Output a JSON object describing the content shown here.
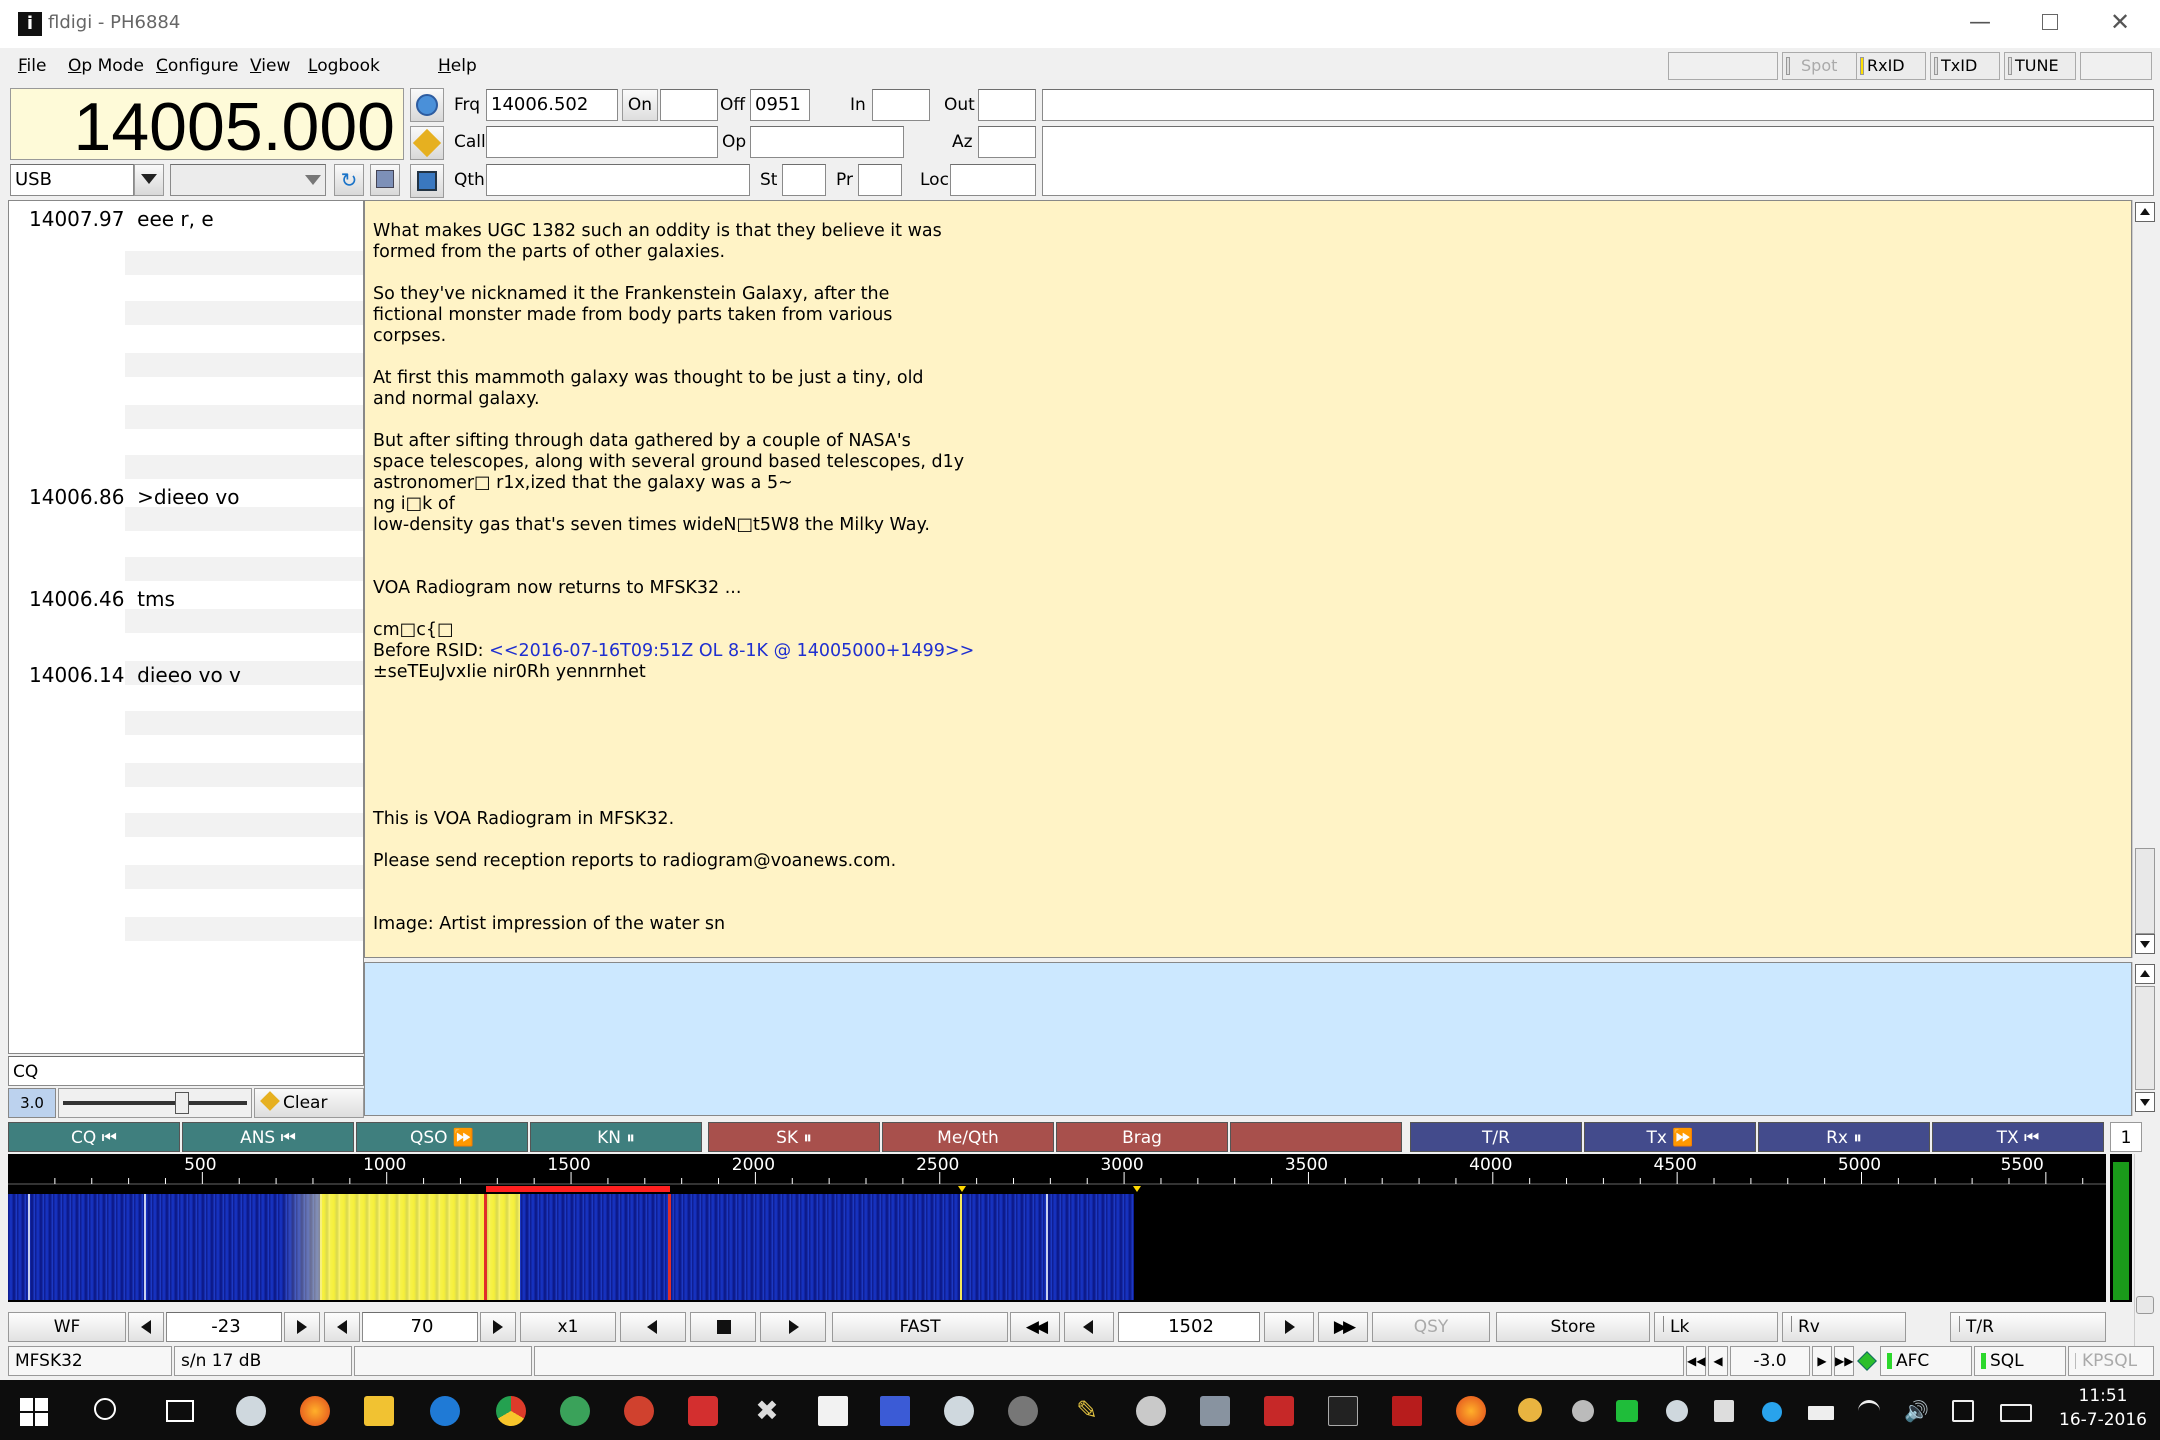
{
  "window": {
    "title": "fldigi - PH6884"
  },
  "menu": [
    "File",
    "Op Mode",
    "Configure",
    "View",
    "Logbook",
    "Help"
  ],
  "toolbar_right": {
    "spot": "Spot",
    "rxid": "RxID",
    "txid": "TxID",
    "tune": "TUNE"
  },
  "freq_display": "14005.000",
  "mode_select": "USB",
  "log": {
    "frq_label": "Frq",
    "frq_value": "14006.502",
    "on_label": "On",
    "on_value": "",
    "off_label": "Off",
    "off_value": "0951",
    "in_label": "In",
    "in_value": "",
    "out_label": "Out",
    "out_value": "",
    "call_label": "Call",
    "call_value": "",
    "op_label": "Op",
    "op_value": "",
    "az_label": "Az",
    "az_value": "",
    "qth_label": "Qth",
    "qth_value": "",
    "st_label": "St",
    "st_value": "",
    "pr_label": "Pr",
    "pr_value": "",
    "loc_label": "Loc",
    "loc_value": ""
  },
  "signal_browser": [
    {
      "freq": "14007.97",
      "text": "eee r,  e"
    },
    {
      "freq": "14006.86",
      "text": ">dieeo vo"
    },
    {
      "freq": "14006.46",
      "text": "tms"
    },
    {
      "freq": "14006.14",
      "text": "dieeo vo v"
    }
  ],
  "browser_search": "CQ",
  "browser_squelch_value": "3.0",
  "browser_clear": "Clear",
  "rx_lines": [
    "What makes UGC 1382 such an oddity is that they believe it was",
    "formed from the parts of other galaxies.",
    "So they've nicknamed it the Frankenstein Galaxy, after the",
    "fictional monster made from body parts taken from various",
    "corpses.",
    "At first this mammoth galaxy was thought to be just a tiny, old",
    "and normal galaxy.",
    "But after sifting through data gathered by a couple of NASA's",
    "space telescopes, along with several ground based telescopes, d1y",
    "astronomer□ r1x,ized that the galaxy was a 5~",
    "ng i□k of",
    "low-density gas that's seven times wideN□t5W8 the Milky Way.",
    "VOA Radiogram now returns to MFSK32 ...",
    "cm□c{□",
    "Before RSID: ",
    "±seTEuJvxIie nir0Rh yennrnhet",
    "This is VOA Radiogram in MFSK32.",
    "Please send reception reports to radiogram@voanews.com.",
    "Image: Artist impression of the water sn"
  ],
  "rsid_tag": "<<2016-07-16T09:51Z OL 8-1K @ 14005000+1499>>",
  "macros": [
    "CQ ⏮",
    "ANS ⏮",
    "QSO ⏩",
    "KN ⏸",
    "SK ⏸",
    "Me/Qth",
    "Brag",
    "",
    "T/R",
    "Tx ⏩",
    "Rx ⏸",
    "TX ⏮"
  ],
  "macro_set": "1",
  "waterfall": {
    "ticks": [
      "500",
      "1000",
      "1500",
      "2000",
      "2500",
      "3000",
      "3500",
      "4000",
      "4500",
      "5000",
      "5500"
    ]
  },
  "wf_controls": {
    "wf": "WF",
    "level": "-23",
    "range": "70",
    "zoom": "x1",
    "speed": "FAST",
    "carrier": "1502",
    "qsy": "QSY",
    "store": "Store",
    "lk": "Lk",
    "rv": "Rv",
    "tr": "T/R"
  },
  "status": {
    "mode": "MFSK32",
    "sn": "s/n  17 dB",
    "afc_value": "-3.0",
    "afc": "AFC",
    "sql": "SQL",
    "kpsql": "KPSQL"
  },
  "taskbar": {
    "time": "11:51",
    "date": "16-7-2016"
  },
  "colors": {
    "rx_bg": "#fff3c6",
    "tx_bg": "#cce8ff",
    "waterfall_bg": "#10189a",
    "signal": "#f4f04a"
  }
}
